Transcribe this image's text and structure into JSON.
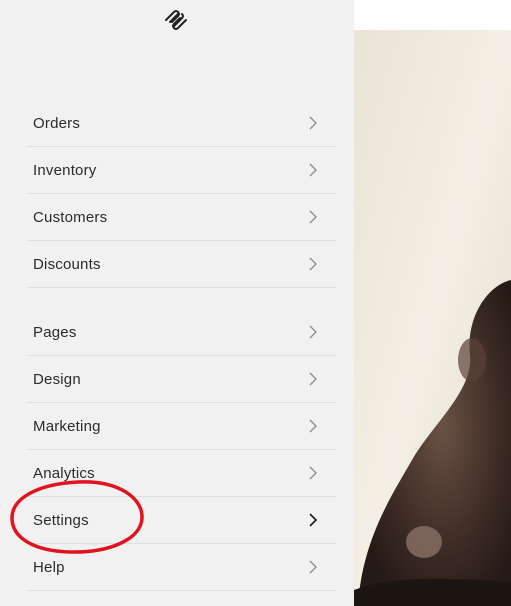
{
  "logo": {
    "icon": "squarespace-logo-icon"
  },
  "nav": {
    "group1": [
      {
        "label": "Orders"
      },
      {
        "label": "Inventory"
      },
      {
        "label": "Customers"
      },
      {
        "label": "Discounts"
      }
    ],
    "group2": [
      {
        "label": "Pages"
      },
      {
        "label": "Design"
      },
      {
        "label": "Marketing"
      },
      {
        "label": "Analytics"
      },
      {
        "label": "Settings"
      },
      {
        "label": "Help"
      }
    ]
  },
  "annotation": {
    "target": "Settings",
    "color": "#e0141e"
  },
  "colors": {
    "sidebar_bg": "#f1f1f1",
    "divider": "#dedede",
    "text": "#2b2b2b"
  }
}
